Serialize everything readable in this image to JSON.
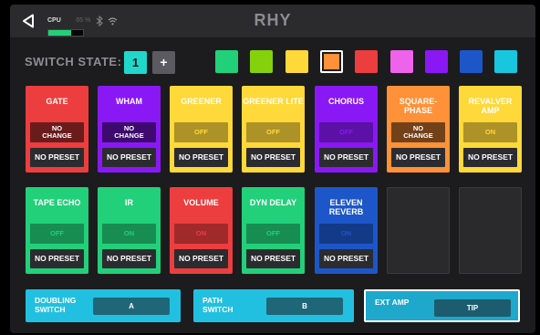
{
  "header": {
    "title": "RHY",
    "cpu_label": "CPU",
    "cpu_percent": "65 %",
    "cpu_level": 0.65
  },
  "switch_state": {
    "label": "SWITCH STATE:",
    "number": "1",
    "add": "+",
    "colors": [
      "#22d07a",
      "#84d20c",
      "#ffd83a",
      "#ff9138",
      "#ec3e3e",
      "#ef63ec",
      "#8a18f5",
      "#1d56c8",
      "#18c6e0"
    ],
    "selected_index": 3
  },
  "blocks": [
    {
      "name": "GATE",
      "color": "#ec3e3e",
      "state": "NO\nCHANGE",
      "preset": "NO PRESET"
    },
    {
      "name": "WHAM",
      "color": "#8a18f5",
      "state": "NO\nCHANGE",
      "preset": "NO PRESET"
    },
    {
      "name": "GREENER",
      "color": "#ffd83a",
      "state": "OFF",
      "preset": "NO PRESET"
    },
    {
      "name": "GREENER LITE",
      "color": "#ffd83a",
      "state": "OFF",
      "preset": "NO PRESET"
    },
    {
      "name": "CHORUS",
      "color": "#8a18f5",
      "state": "OFF",
      "preset": "NO PRESET"
    },
    {
      "name": "SQUARE-\nPHASE",
      "color": "#ff9138",
      "state": "NO\nCHANGE",
      "preset": "NO PRESET"
    },
    {
      "name": "REVALVER\nAMP",
      "color": "#ffd83a",
      "state": "ON",
      "preset": "NO PRESET"
    },
    {
      "name": "TAPE ECHO",
      "color": "#22d07a",
      "state": "OFF",
      "preset": "NO PRESET"
    },
    {
      "name": "IR",
      "color": "#22d07a",
      "state": "ON",
      "preset": "NO PRESET"
    },
    {
      "name": "VOLUME",
      "color": "#ec3e3e",
      "state": "ON",
      "preset": "NO PRESET"
    },
    {
      "name": "DYN DELAY",
      "color": "#22d07a",
      "state": "OFF",
      "preset": "NO PRESET"
    },
    {
      "name": "ELEVEN\nREVERB",
      "color": "#1d56c8",
      "state": "ON",
      "preset": "NO PRESET"
    }
  ],
  "bottom": [
    {
      "label": "DOUBLING\nSWITCH",
      "value": "A",
      "selected": false
    },
    {
      "label": "PATH\nSWITCH",
      "value": "B",
      "selected": false
    },
    {
      "label": "EXT AMP",
      "value": "TIP",
      "selected": true
    }
  ]
}
